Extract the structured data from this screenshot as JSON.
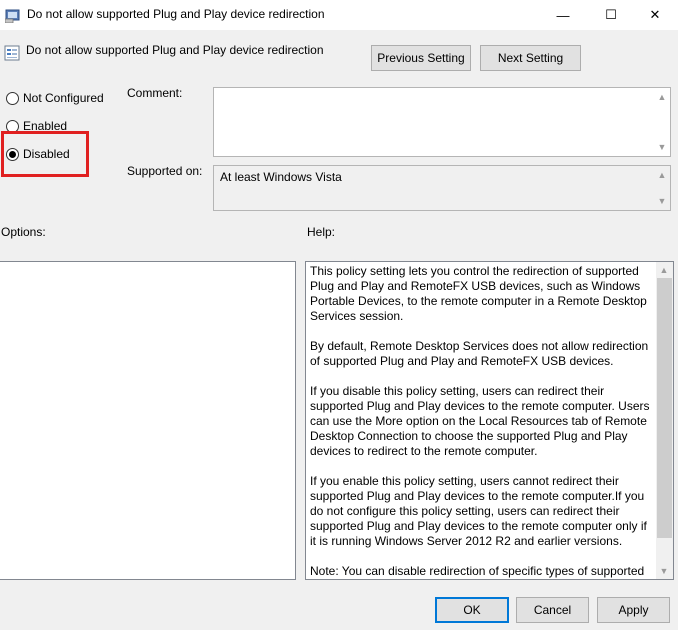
{
  "window": {
    "title": "Do not allow supported Plug and Play device redirection",
    "minimize_glyph": "—",
    "maximize_glyph": "☐",
    "close_glyph": "✕"
  },
  "header": {
    "title": "Do not allow supported Plug and Play device redirection",
    "previous_label": "Previous Setting",
    "next_label": "Next Setting"
  },
  "state": {
    "options": [
      {
        "label": "Not Configured",
        "selected": false
      },
      {
        "label": "Enabled",
        "selected": false
      },
      {
        "label": "Disabled",
        "selected": true
      }
    ]
  },
  "comment": {
    "label": "Comment:",
    "value": ""
  },
  "supported": {
    "label": "Supported on:",
    "value": "At least Windows Vista"
  },
  "options_label": "Options:",
  "help": {
    "label": "Help:",
    "paragraphs": [
      "This policy setting lets you control the redirection of supported Plug and Play and RemoteFX USB devices, such as Windows Portable Devices, to the remote computer in a Remote Desktop Services session.",
      "By default, Remote Desktop Services does not allow redirection of supported Plug and Play and RemoteFX USB devices.",
      "If you disable this policy setting, users can redirect their supported Plug and Play devices to the remote computer. Users can use the More option on the Local Resources tab of Remote Desktop Connection to choose the supported Plug and Play devices to redirect to the remote computer.",
      "If you enable this policy setting, users cannot redirect their supported Plug and Play devices to the remote computer.If you do not configure this policy setting, users can redirect their supported Plug and Play devices to the remote computer only if it is running Windows Server 2012 R2 and earlier versions.",
      "Note: You can disable redirection of specific types of supported Plug and Play devices by using Computer Configuration"
    ]
  },
  "footer": {
    "ok_label": "OK",
    "cancel_label": "Cancel",
    "apply_label": "Apply"
  },
  "colors": {
    "highlight": "#e02020",
    "accent": "#0078d7"
  }
}
